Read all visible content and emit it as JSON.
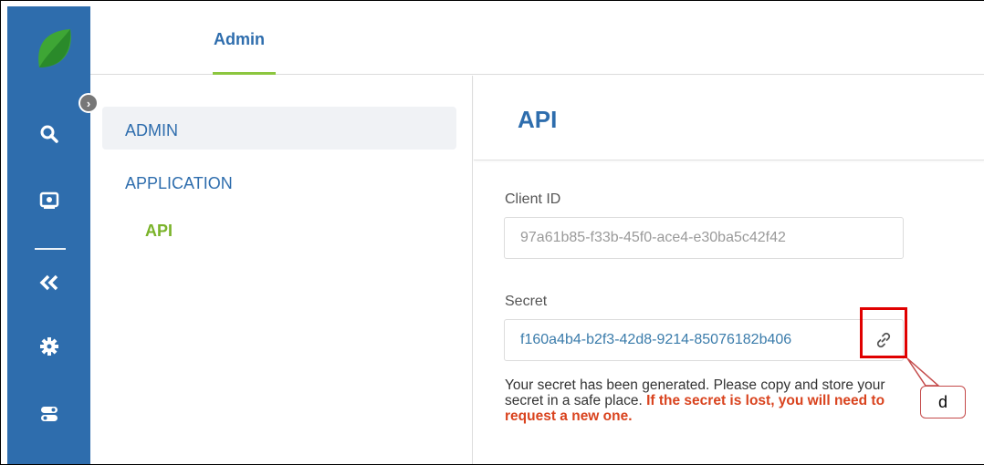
{
  "topbar": {
    "tab_admin": "Admin"
  },
  "nav": {
    "admin": "ADMIN",
    "application": "APPLICATION",
    "api": "API"
  },
  "rail": {
    "icons": [
      "search-icon",
      "monitor-icon",
      "double-chevron-left-icon",
      "gear-icon",
      "toggle-icon"
    ]
  },
  "content": {
    "title": "API",
    "client_id_label": "Client ID",
    "client_id_value": "97a61b85-f33b-45f0-ace4-e30ba5c42f42",
    "secret_label": "Secret",
    "secret_value": "f160a4b4-b2f3-42d8-9214-85076182b406",
    "help_text": "Your secret has been generated. Please copy and store your secret in a safe place. ",
    "help_warning": "If the secret is lost, you will need to request a new one."
  },
  "annotation": {
    "label": "d"
  },
  "colors": {
    "rail": "#2e6dad",
    "brand_blue": "#2e6dad",
    "accent_green": "#8cc63f",
    "warning": "#d9431e",
    "annotation_red": "#e00000"
  }
}
